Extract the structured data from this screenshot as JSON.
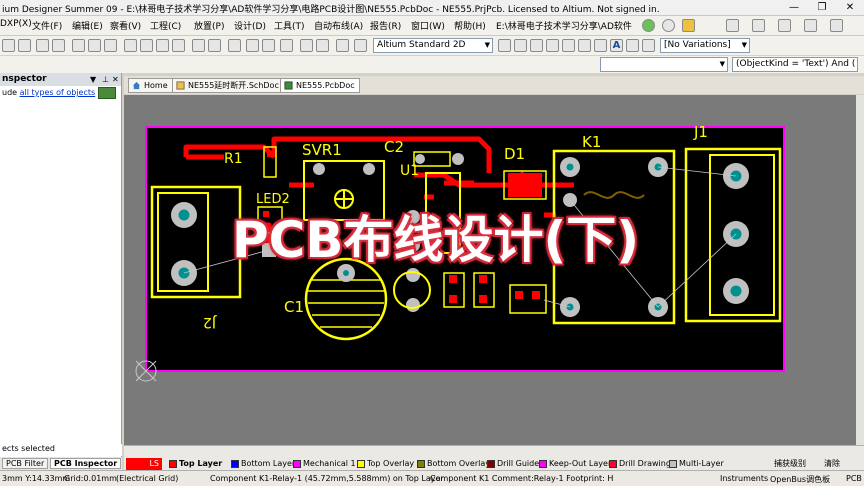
{
  "window": {
    "title": "ium Designer Summer 09 - E:\\林哥电子技术学习分享\\AD软件学习分享\\电路PCB设计图\\NE555.PcbDoc - NE555.PrjPcb. Licensed to Altium. Not signed in."
  },
  "menu": [
    "DXP(X)",
    "文件(F)",
    "编辑(E)",
    "察看(V)",
    "工程(C)",
    "放置(P)",
    "设计(D)",
    "工具(T)",
    "自动布线(A)",
    "报告(R)",
    "窗口(W)",
    "帮助(H)",
    "E:\\林哥电子技术学习分享\\AD软件"
  ],
  "toolbar": {
    "layerset_combo": "Altium Standard 2D",
    "variations_combo": "[No Variations]",
    "filter_query": "(ObjectKind = 'Text') And ("
  },
  "inspector": {
    "title": "nspector",
    "include_text": "ude",
    "include_link": "all types of objects",
    "selected_text": "ects selected",
    "tabs": [
      "PCB Filter",
      "PCB Inspector"
    ]
  },
  "doc_tabs": [
    "Home",
    "NE555延时断开.SchDoc",
    "NE555.PcbDoc"
  ],
  "pcb": {
    "designators": [
      "R1",
      "SVR1",
      "C2",
      "U1",
      "D1",
      "K1",
      "J1",
      "LED2",
      "C1",
      "J2"
    ],
    "overlay_title": "PCB布线设计(下)"
  },
  "layers": [
    {
      "name": "LS",
      "color": "#ff0000"
    },
    {
      "name": "Top Layer",
      "color": "#ff0000"
    },
    {
      "name": "Bottom Layer",
      "color": "#0000ff"
    },
    {
      "name": "Mechanical 1",
      "color": "#ff00ff"
    },
    {
      "name": "Top Overlay",
      "color": "#ffff00"
    },
    {
      "name": "Bottom Overlay",
      "color": "#808000"
    },
    {
      "name": "Drill Guide",
      "color": "#800000"
    },
    {
      "name": "Keep-Out Layer",
      "color": "#ff00ff"
    },
    {
      "name": "Drill Drawing",
      "color": "#ff002a"
    },
    {
      "name": "Multi-Layer",
      "color": "#c0c0c0"
    }
  ],
  "status": {
    "coords": "3mm Y:14.33mm",
    "grid": "Grid:0.01mm",
    "grid_type": "(Electrical Grid)",
    "component1": "Component K1-Relay-1 (45.72mm,5.588mm) on Top Layer",
    "component2": "Component K1 Comment:Relay-1 Footprint: H",
    "right1": "Instruments",
    "right2": "OpenBus调色板",
    "right3": "PCB",
    "snap": "捕获级别",
    "clear": "清除"
  }
}
